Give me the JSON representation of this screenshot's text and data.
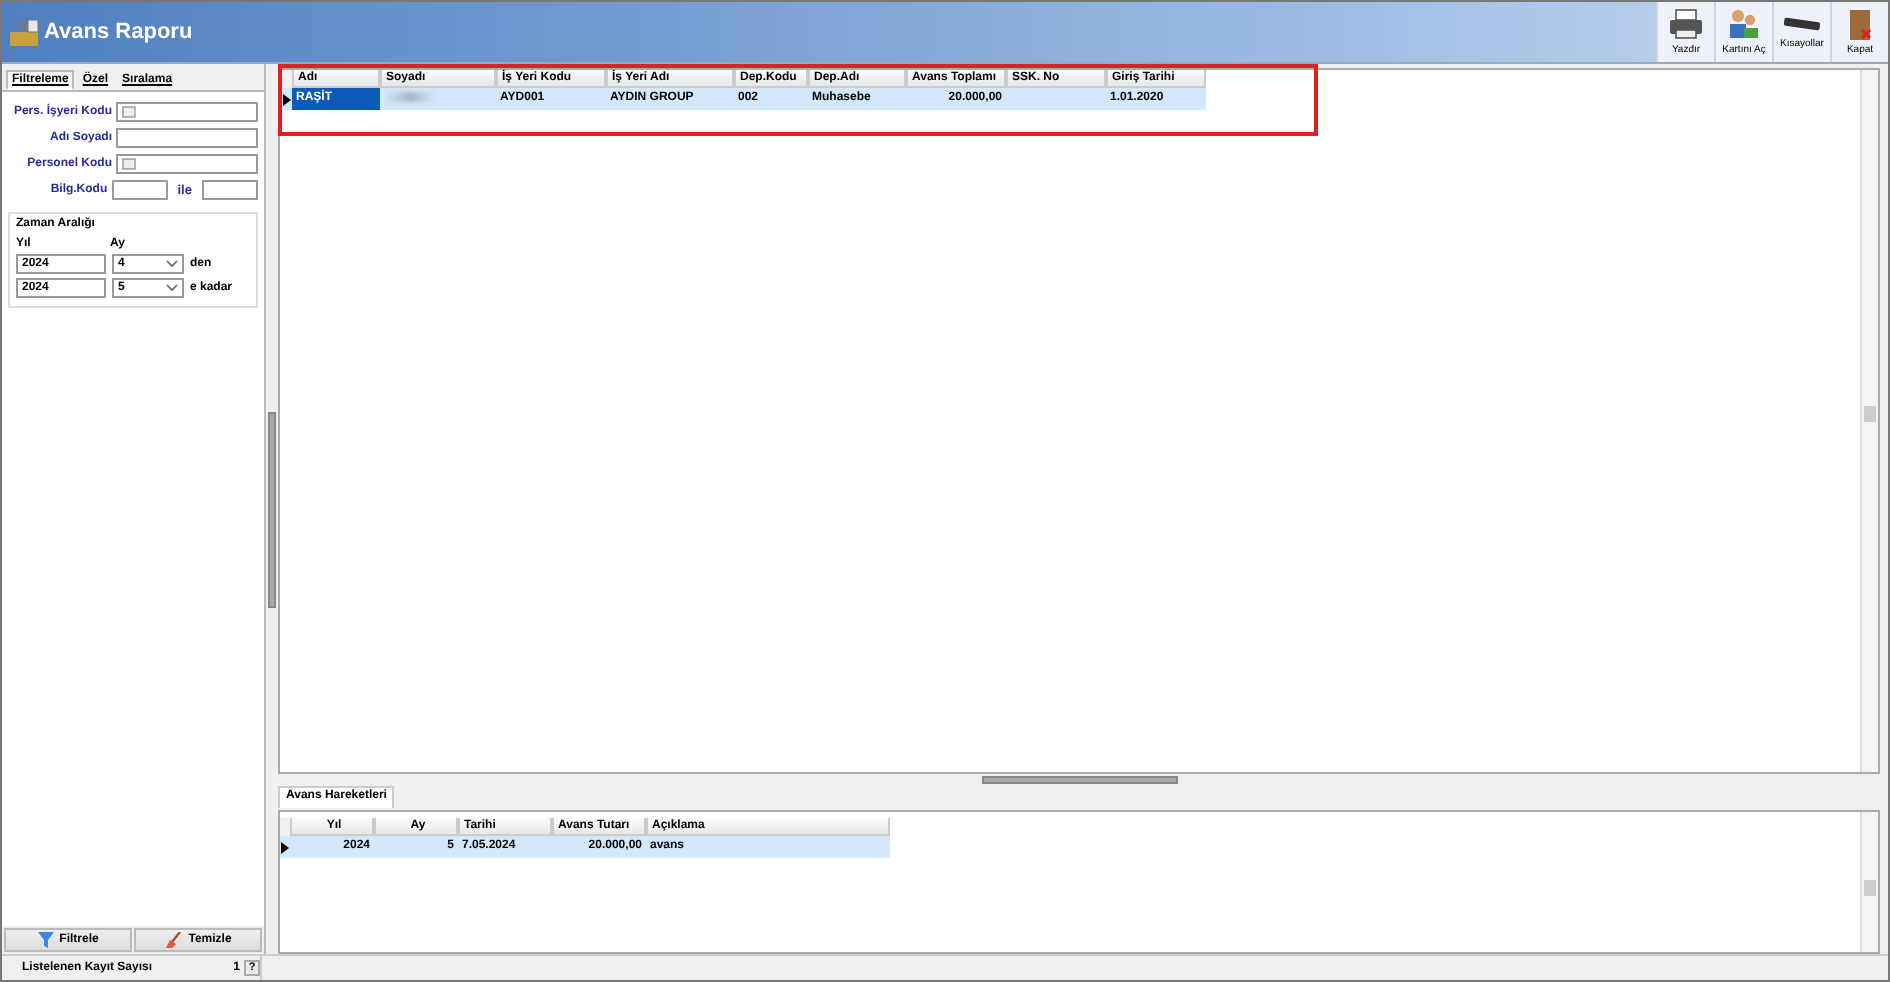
{
  "window": {
    "title": "Avans Raporu"
  },
  "toolbar": [
    {
      "label": "Yazdır",
      "kind": "print"
    },
    {
      "label": "Kartını Aç",
      "kind": "card"
    },
    {
      "label": "Kısayollar",
      "kind": "shortcuts"
    },
    {
      "label": "Kapat",
      "kind": "close"
    }
  ],
  "filter_tabs": [
    {
      "label": "Filtreleme",
      "selected": true
    },
    {
      "label": "Özel",
      "selected": false
    },
    {
      "label": "Sıralama",
      "selected": false
    }
  ],
  "fields": [
    {
      "label": "Pers. İşyeri Kodu",
      "kind": "lookup"
    },
    {
      "label": "Adı Soyadı",
      "kind": "text"
    },
    {
      "label": "Personel Kodu",
      "kind": "lookup"
    },
    {
      "label": "Bilg.Kodu",
      "kind": "range",
      "connector": "ile"
    }
  ],
  "time_range": {
    "title": "Zaman Aralığı",
    "year_label": "Yıl",
    "month_label": "Ay",
    "rows": [
      {
        "year": "2024",
        "month": "4",
        "suffix": "den"
      },
      {
        "year": "2024",
        "month": "5",
        "suffix": "e kadar"
      }
    ]
  },
  "filter_buttons": [
    {
      "label": "Filtrele",
      "kind": "filter"
    },
    {
      "label": "Temizle",
      "kind": "clear"
    }
  ],
  "status_bar": {
    "label": "Listelenen Kayıt Sayısı",
    "count": "1",
    "help": "?"
  },
  "table": {
    "columns": [
      "Adı",
      "Soyadı",
      "İş Yeri Kodu",
      "İş Yeri Adı",
      "Dep.Kodu",
      "Dep.Adı",
      "Avans Toplamı",
      "SSK. No",
      "Giriş Tarihi"
    ],
    "rows": [
      {
        "selected": true,
        "cells": [
          "RAŞİT",
          null,
          "AYD001",
          "AYDIN GROUP",
          "002",
          "Muhasebe",
          "20.000,00",
          null,
          "1.01.2020"
        ]
      }
    ]
  },
  "detail": {
    "tab": "Avans Hareketleri",
    "columns": [
      "Yıl",
      "Ay",
      "Tarihi",
      "Avans Tutarı",
      "Açıklama"
    ],
    "rows": [
      {
        "selected": true,
        "cells": [
          "2024",
          "5",
          "7.05.2024",
          "20.000,00",
          "avans"
        ]
      }
    ]
  }
}
